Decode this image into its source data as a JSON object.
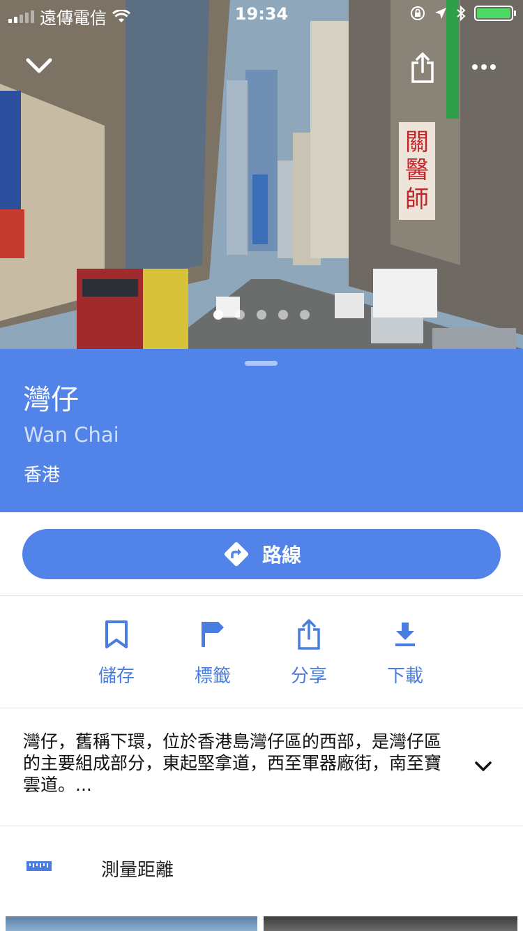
{
  "status": {
    "carrier": "遠傳電信",
    "time": "19:34",
    "battery_color": "#4cd964"
  },
  "hero": {
    "photo_count": 5,
    "active_photo": 1,
    "icons": {
      "collapse": "chevron-down-icon",
      "share": "share-icon",
      "more": "more-icon"
    }
  },
  "place": {
    "title": "灣仔",
    "subtitle": "Wan Chai",
    "region": "香港",
    "accent_color": "#5183e8"
  },
  "directions": {
    "label": "路線",
    "icon": "directions-icon"
  },
  "actions": [
    {
      "label": "儲存",
      "icon": "bookmark-icon"
    },
    {
      "label": "標籤",
      "icon": "flag-icon"
    },
    {
      "label": "分享",
      "icon": "share-icon"
    },
    {
      "label": "下載",
      "icon": "download-icon"
    }
  ],
  "description": {
    "text": "灣仔，舊稱下環，位於香港島灣仔區的西部，是灣仔區的主要組成部分，東起堅拿道，西至軍器廠街，南至寶雲道。..."
  },
  "measure": {
    "label": "測量距離",
    "icon": "ruler-icon"
  }
}
